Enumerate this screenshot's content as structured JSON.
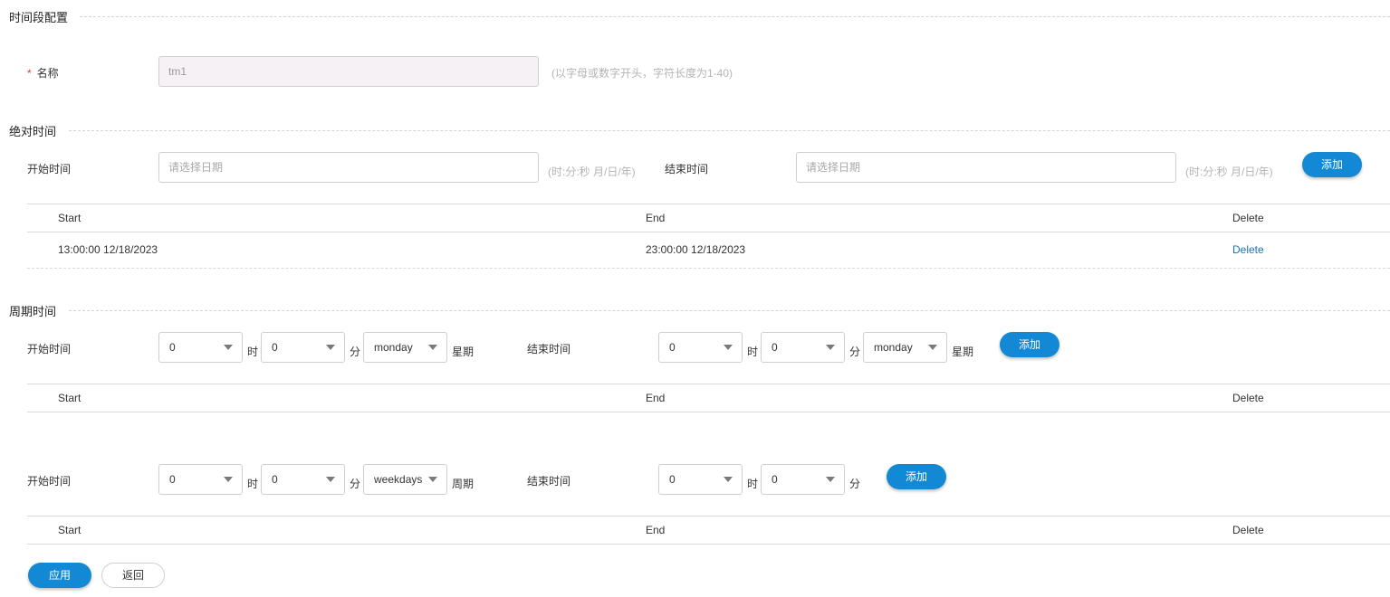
{
  "section_config": {
    "title": "时间段配置"
  },
  "name_field": {
    "required_mark": "*",
    "label": "名称",
    "value": "tm1",
    "hint": "(以字母或数字开头，字符长度为1-40)"
  },
  "absolute": {
    "title": "绝对时间",
    "start_label": "开始时间",
    "start_placeholder": "请选择日期",
    "start_hint": "(时:分:秒 月/日/年)",
    "end_label": "结束时间",
    "end_placeholder": "请选择日期",
    "end_hint": "(时:分:秒 月/日/年)",
    "add_label": "添加",
    "table": {
      "col_start": "Start",
      "col_end": "End",
      "col_delete": "Delete",
      "rows": [
        {
          "start": "13:00:00 12/18/2023",
          "end": "23:00:00 12/18/2023",
          "action": "Delete"
        }
      ]
    }
  },
  "periodic": {
    "title": "周期时间",
    "weekly": {
      "start_label": "开始时间",
      "start_hour": "0",
      "hour_unit": "时",
      "start_minute": "0",
      "minute_unit": "分",
      "start_day": "monday",
      "day_unit": "星期",
      "end_label": "结束时间",
      "end_hour": "0",
      "end_hour_unit": "时",
      "end_minute": "0",
      "end_minute_unit": "分",
      "end_day": "monday",
      "end_day_unit": "星期",
      "add_label": "添加",
      "table": {
        "col_start": "Start",
        "col_end": "End",
        "col_delete": "Delete"
      }
    },
    "daily": {
      "start_label": "开始时间",
      "start_hour": "0",
      "hour_unit": "时",
      "start_minute": "0",
      "minute_unit": "分",
      "start_type": "weekdays",
      "type_unit": "周期",
      "end_label": "结束时间",
      "end_hour": "0",
      "end_hour_unit": "时",
      "end_minute": "0",
      "end_minute_unit": "分",
      "add_label": "添加",
      "table": {
        "col_start": "Start",
        "col_end": "End",
        "col_delete": "Delete"
      }
    }
  },
  "footer": {
    "apply_label": "应用",
    "back_label": "返回"
  },
  "colors": {
    "primary": "#1389d6",
    "link": "#1a73b8",
    "required": "#e53935"
  }
}
